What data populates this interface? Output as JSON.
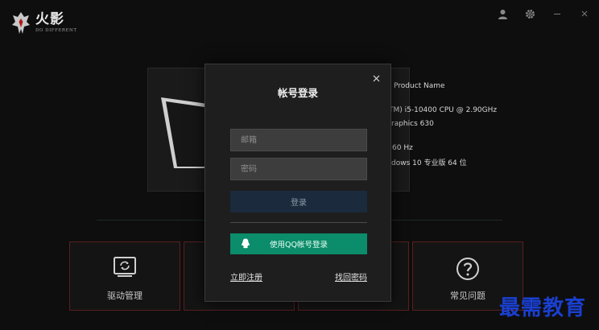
{
  "brand": {
    "name": "火影",
    "slogan": "DO DIFFERENT"
  },
  "window_controls": [
    "user-icon",
    "gear-icon",
    "minimize-icon",
    "close-icon"
  ],
  "product": {
    "product_name": "Product Name",
    "cpu": "TM) i5-10400 CPU @ 2.90GHz",
    "graphics": "raphics 630",
    "refresh": "60 Hz",
    "os": "dows 10 专业版  64 位"
  },
  "features": [
    {
      "label": "驱动管理",
      "icon": "driver-icon"
    },
    {
      "label": "常见问题",
      "icon": "question-icon"
    }
  ],
  "modal": {
    "title": "帐号登录",
    "email_placeholder": "邮箱",
    "password_placeholder": "密码",
    "login_label": "登录",
    "qq_login_label": "使用QQ帐号登录",
    "register_label": "立即注册",
    "forgot_label": "找回密码"
  },
  "watermark": "最需教育",
  "colors": {
    "qq_green": "#0b8c6a",
    "login_navy": "#1b2a3c",
    "feature_border": "#5a1f1f",
    "watermark_blue": "#1a3fd0"
  }
}
